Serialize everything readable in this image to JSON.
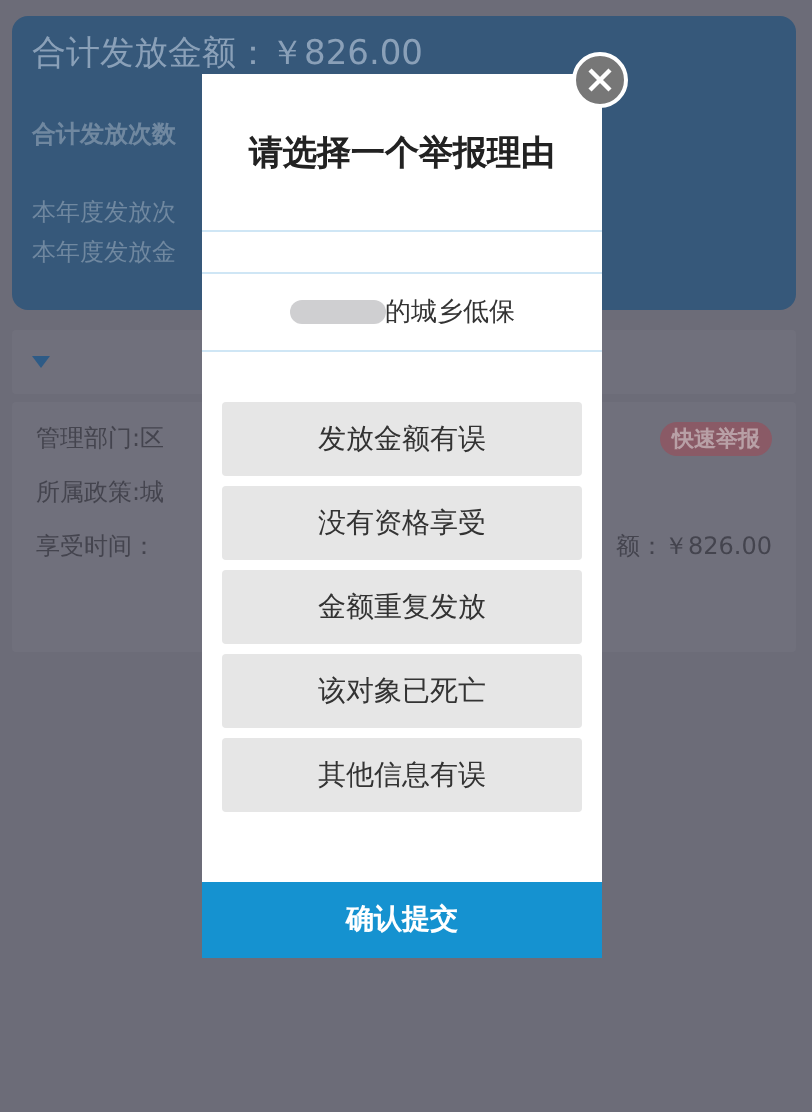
{
  "summary": {
    "total_amount": "合计发放金额：￥826.00",
    "total_count": "合计发放次数",
    "year_count": "本年度发放次",
    "year_amount": "本年度发放金"
  },
  "record": {
    "department": "管理部门:区",
    "policy": "所属政策:城",
    "period": "享受时间：",
    "amount": "额：￥826.00",
    "report_badge": "快速举报"
  },
  "dialog": {
    "title": "请选择一个举报理由",
    "subject": "的城乡低保",
    "reasons": [
      {
        "label": "发放金额有误"
      },
      {
        "label": "没有资格享受"
      },
      {
        "label": "金额重复发放"
      },
      {
        "label": "该对象已死亡"
      },
      {
        "label": "其他信息有误"
      }
    ],
    "submit": "确认提交"
  }
}
